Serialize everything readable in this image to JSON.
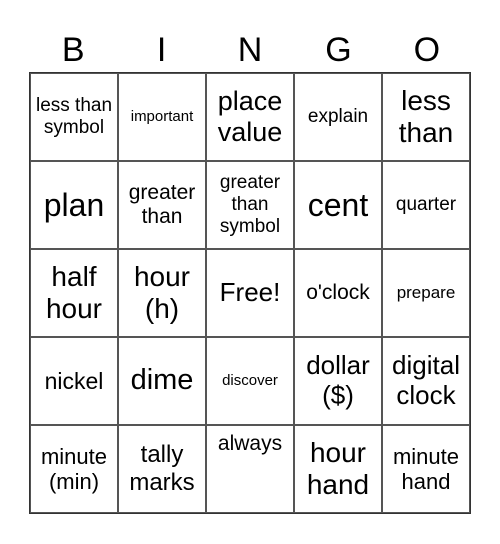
{
  "header": {
    "letters": [
      "B",
      "I",
      "N",
      "G",
      "O"
    ]
  },
  "cells": [
    [
      "less than symbol",
      "important",
      "place value",
      "explain",
      "less than"
    ],
    [
      "plan",
      "greater than",
      "greater than symbol",
      "cent",
      "quarter"
    ],
    [
      "half hour",
      "hour (h)",
      "Free!",
      "o'clock",
      "prepare"
    ],
    [
      "nickel",
      "dime",
      "discover",
      "dollar ($)",
      "digital clock"
    ],
    [
      "minute (min)",
      "tally marks",
      "always",
      "hour hand",
      "minute hand"
    ]
  ]
}
